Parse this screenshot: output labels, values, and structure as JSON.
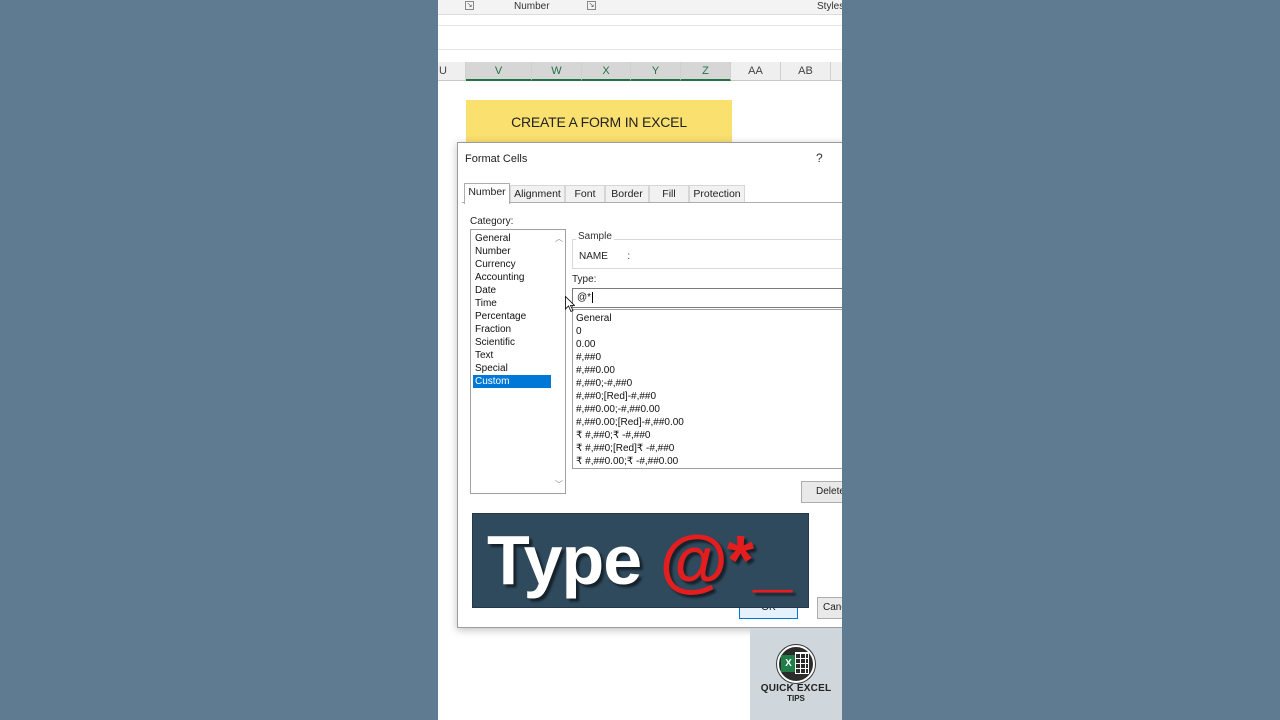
{
  "ribbon": {
    "group_number": "Number",
    "group_styles": "Styles"
  },
  "columns": [
    "U",
    "V",
    "W",
    "X",
    "Y",
    "Z",
    "AA",
    "AB"
  ],
  "sheet": {
    "form_title": "CREATE A FORM IN EXCEL"
  },
  "dialog": {
    "title": "Format Cells",
    "help": "?",
    "tabs": [
      "Number",
      "Alignment",
      "Font",
      "Border",
      "Fill",
      "Protection"
    ],
    "category_label": "Category:",
    "categories": [
      "General",
      "Number",
      "Currency",
      "Accounting",
      "Date",
      "Time",
      "Percentage",
      "Fraction",
      "Scientific",
      "Text",
      "Special",
      "Custom"
    ],
    "selected_category": "Custom",
    "sample_label": "Sample",
    "sample_value": "NAME       :",
    "type_label": "Type:",
    "type_value": "@*",
    "formats": [
      "General",
      "0",
      "0.00",
      "#,##0",
      "#,##0.00",
      "#,##0;-#,##0",
      "#,##0;[Red]-#,##0",
      "#,##0.00;-#,##0.00",
      "#,##0.00;[Red]-#,##0.00",
      "₹ #,##0;₹ -#,##0",
      "₹ #,##0;[Red]₹ -#,##0",
      "₹ #,##0.00;₹ -#,##0.00"
    ],
    "delete_label": "Delete",
    "ok_label": "OK",
    "cancel_label": "Cancel",
    "partial_label": "T"
  },
  "caption": {
    "text": "Type ",
    "accent": "@*_"
  },
  "logo": {
    "line1": "QUICK EXCEL",
    "line2": "TIPS",
    "badge": "X"
  },
  "colors": {
    "excel_green": "#217346",
    "selection_blue": "#0078d7",
    "title_yellow": "#f9e06f",
    "caption_bg": "#2f4a5d",
    "accent_red": "#e41e1e"
  }
}
